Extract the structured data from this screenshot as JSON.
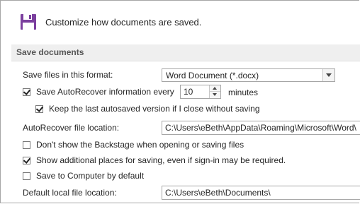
{
  "header": {
    "icon": "floppy-disk-icon",
    "accent_color": "#7b3f9e",
    "description": "Customize how documents are saved."
  },
  "section": {
    "title": "Save documents"
  },
  "format": {
    "label": "Save files in this format:",
    "selected": "Word Document (*.docx)"
  },
  "autorecover": {
    "checked": true,
    "label": "Save AutoRecover information every",
    "minutes_value": "10",
    "minutes_label": "minutes"
  },
  "keep_last": {
    "checked": true,
    "label": "Keep the last autosaved version if I close without saving"
  },
  "autorecover_location": {
    "label": "AutoRecover file location:",
    "value": "C:\\Users\\eBeth\\AppData\\Roaming\\Microsoft\\Word\\"
  },
  "backstage": {
    "checked": false,
    "label": "Don't show the Backstage when opening or saving files"
  },
  "additional_places": {
    "checked": true,
    "label": "Show additional places for saving, even if sign-in may be required."
  },
  "save_computer": {
    "checked": false,
    "label": "Save to Computer by default"
  },
  "default_location": {
    "label": "Default local file location:",
    "value": "C:\\Users\\eBeth\\Documents\\"
  }
}
